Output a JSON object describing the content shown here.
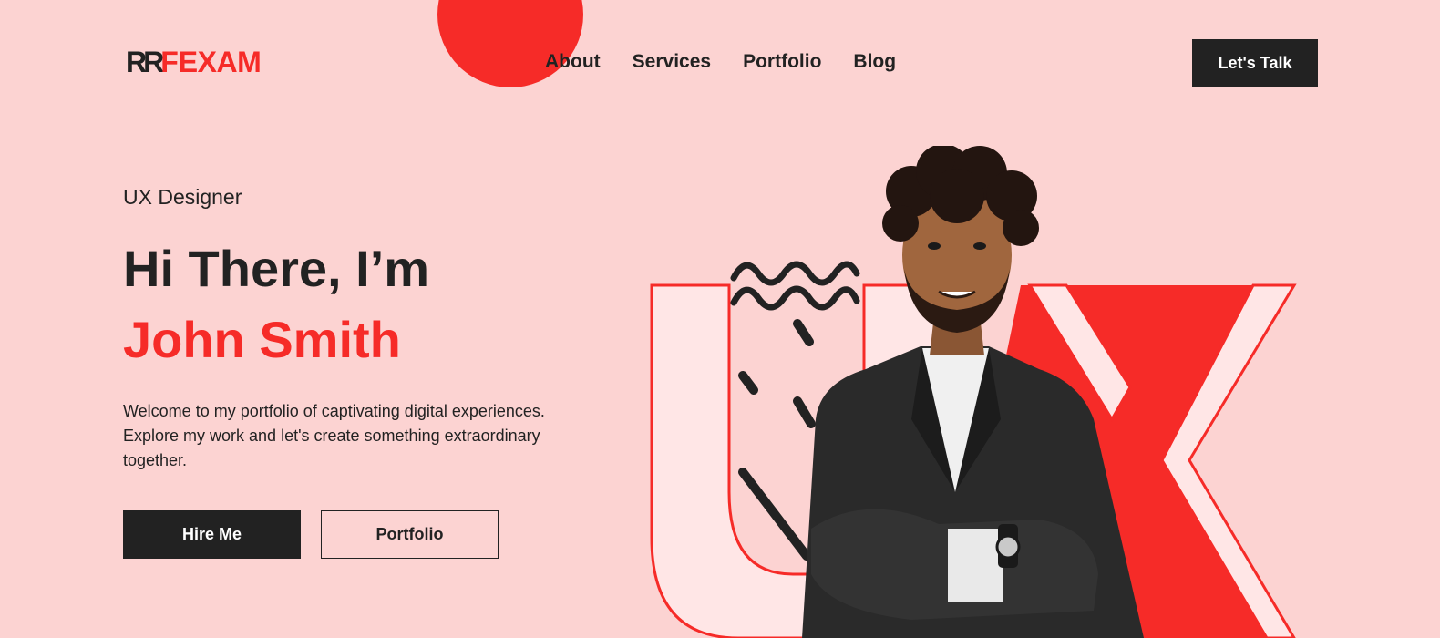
{
  "colors": {
    "background": "#FCD3D2",
    "accent": "#F62B28",
    "dark": "#222222",
    "light": "#FFE6E6"
  },
  "header": {
    "logo_mark": "RR",
    "logo_mark_f": "F",
    "logo_name": "EXAM",
    "nav": [
      "About",
      "Services",
      "Portfolio",
      "Blog"
    ],
    "cta_label": "Let's Talk"
  },
  "hero": {
    "role": "UX Designer",
    "greeting": "Hi There, I’m",
    "name": "John Smith",
    "intro": "Welcome to my portfolio of captivating digital experiences. Explore my work and let's create something extraordinary together.",
    "primary_button": "Hire Me",
    "secondary_button": "Portfolio"
  },
  "art": {
    "letters": "UX",
    "person_icon": "person-portrait-icon",
    "squiggle_icon": "wave-squiggle-icon"
  }
}
